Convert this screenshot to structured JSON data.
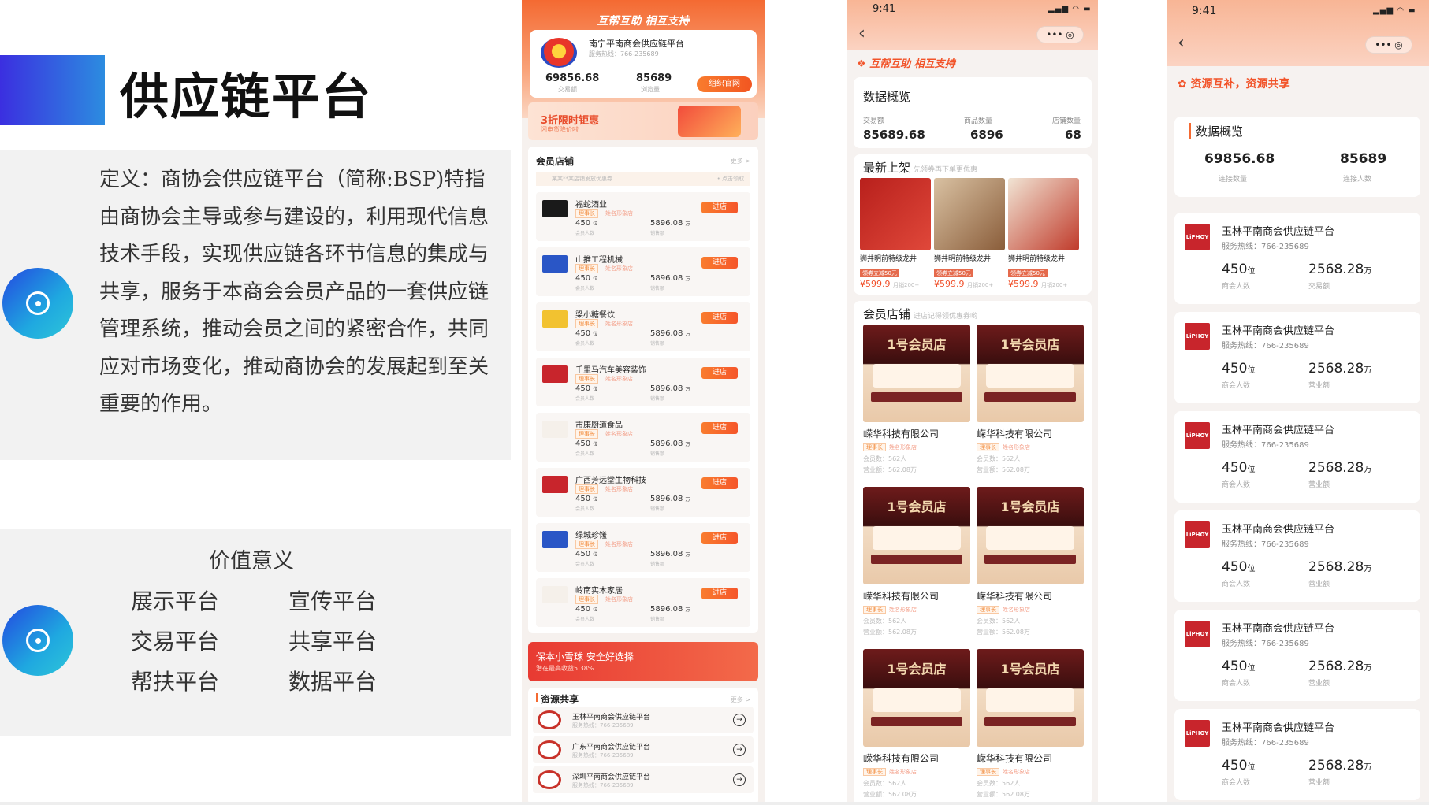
{
  "slide": {
    "title": "供应链平台",
    "definition": "定义：商协会供应链平台（简称:BSP)特指由商协会主导或参与建设的，利用现代信息技术手段，实现供应链各环节信息的集成与共享，服务于本商会会员产品的一套供应链管理系统，推动会员之间的紧密合作，共同应对市场变化，推动商协会的发展起到至关重要的作用。",
    "value_title": "价值意义",
    "values": [
      "展示平台",
      "宣传平台",
      "交易平台",
      "共享平台",
      "帮扶平台",
      "数据平台"
    ]
  },
  "phone1": {
    "slogan": "互帮互助 相互支持",
    "org_name": "南宁平南商会供应链平台",
    "hotline": "服务热线：766-235689",
    "stat1_value": "69856.68",
    "stat1_label": "交易额",
    "stat2_value": "85689",
    "stat2_label": "浏览量",
    "official_btn": "组织官网",
    "promo_title": "3折限时钜惠",
    "promo_sub": "闪电货降价啦",
    "shops_title": "会员店铺",
    "more": "更多 >",
    "coupon": "某某**某店铺发放优惠券",
    "coupon_action": "• 点击领取",
    "tag1": "理事长",
    "tag2": "姓名形象店",
    "members_unit": "位",
    "members_label": "会员人数",
    "sales_unit": "万",
    "sales_label": "销售额",
    "enter": "进店",
    "shops": [
      {
        "name": "福蛇酒业",
        "members": "450",
        "sales": "5896.08"
      },
      {
        "name": "山推工程机械",
        "members": "450",
        "sales": "5896.08"
      },
      {
        "name": "梁小糖餐饮",
        "members": "450",
        "sales": "5896.08"
      },
      {
        "name": "千里马汽车美容装饰",
        "members": "450",
        "sales": "5896.08"
      },
      {
        "name": "市康厨道食品",
        "members": "450",
        "sales": "5896.08"
      },
      {
        "name": "广西芳远堂生物科技",
        "members": "450",
        "sales": "5896.08"
      },
      {
        "name": "绿城珍馐",
        "members": "450",
        "sales": "5896.08"
      },
      {
        "name": "岭南实木家居",
        "members": "450",
        "sales": "5896.08"
      }
    ],
    "banner_title": "保本小雪球 安全好选择",
    "banner_sub": "潜在最高收益5.38%",
    "resources_title": "资源共享",
    "resources": [
      {
        "name": "玉林平南商会供应链平台",
        "hotline": "服务热线：766-235689"
      },
      {
        "name": "广东平南商会供应链平台",
        "hotline": "服务热线：766-235689"
      },
      {
        "name": "深圳平南商会供应链平台",
        "hotline": "服务热线：766-235689"
      }
    ]
  },
  "phone2": {
    "time": "9:41",
    "slogan": "互帮互助 相互支持",
    "overview_title": "数据概览",
    "stats": [
      {
        "label": "交易额",
        "value": "85689.68"
      },
      {
        "label": "商品数量",
        "value": "6896"
      },
      {
        "label": "店铺数量",
        "value": "68"
      }
    ],
    "new_title": "最新上架",
    "new_sub": "先领券再下单更优惠",
    "products": [
      {
        "name": "狮井明前特级龙井",
        "coupon": "领券立减50元",
        "price": "¥599.9",
        "sold": "月销200+"
      },
      {
        "name": "狮井明前特级龙井",
        "coupon": "领券立减50元",
        "price": "¥599.9",
        "sold": "月销200+"
      },
      {
        "name": "狮井明前特级龙井",
        "coupon": "领券立减50元",
        "price": "¥599.9",
        "sold": "月销200+"
      }
    ],
    "shops_title": "会员店铺",
    "shops_sub": "进店记得领优惠券哟",
    "shop_brand": "1号会员店",
    "shop_name": "嵘华科技有限公司",
    "tag1": "理事长",
    "tag2": "姓名形象店",
    "members": "会员数：562人",
    "revenue": "营业额：562.08万"
  },
  "phone3": {
    "time": "9:41",
    "slogan": "资源互补，资源共享",
    "overview_title": "数据概览",
    "stat1_value": "69856.68",
    "stat1_label": "连接数量",
    "stat2_value": "85689",
    "stat2_label": "连接人数",
    "logo_text": "LiPHOY",
    "cards": [
      {
        "name": "玉林平南商会供应链平台",
        "hotline": "服务热线：766-235689",
        "members": "450",
        "amount": "2568.28",
        "amount_label": "交易额"
      },
      {
        "name": "玉林平南商会供应链平台",
        "hotline": "服务热线：766-235689",
        "members": "450",
        "amount": "2568.28",
        "amount_label": "营业额"
      },
      {
        "name": "玉林平南商会供应链平台",
        "hotline": "服务热线：766-235689",
        "members": "450",
        "amount": "2568.28",
        "amount_label": "营业额"
      },
      {
        "name": "玉林平南商会供应链平台",
        "hotline": "服务热线：766-235689",
        "members": "450",
        "amount": "2568.28",
        "amount_label": "营业额"
      },
      {
        "name": "玉林平南商会供应链平台",
        "hotline": "服务热线：766-235689",
        "members": "450",
        "amount": "2568.28",
        "amount_label": "营业额"
      },
      {
        "name": "玉林平南商会供应链平台",
        "hotline": "服务热线：766-235689",
        "members": "450",
        "amount": "2568.28",
        "amount_label": "营业额"
      }
    ],
    "members_unit": "位",
    "members_label": "商会人数",
    "amount_unit": "万"
  }
}
